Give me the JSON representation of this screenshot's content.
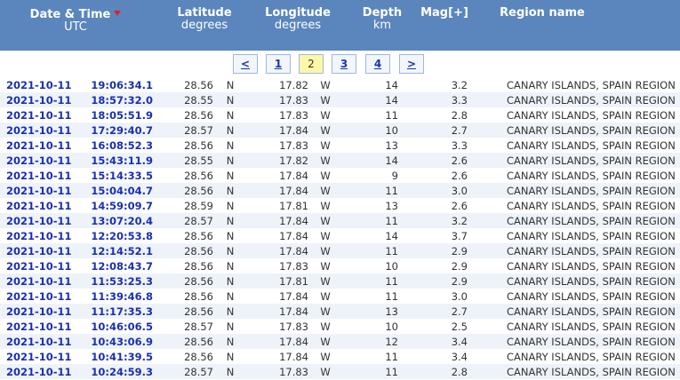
{
  "header": {
    "date": {
      "title": "Date & Time",
      "sub": "UTC"
    },
    "lat": {
      "title": "Latitude",
      "sub": "degrees"
    },
    "lon": {
      "title": "Longitude",
      "sub": "degrees"
    },
    "depth": {
      "title": "Depth",
      "sub": "km"
    },
    "mag": {
      "title": "Mag[+]"
    },
    "region": {
      "title": "Region name"
    },
    "sort_color": "#e0202a",
    "bg_color": "#5a86bd"
  },
  "pager": {
    "prev": "<",
    "p1": "1",
    "p2": "2",
    "p3": "3",
    "p4": "4",
    "next": ">",
    "current": "2"
  },
  "rows": [
    {
      "date": "2021-10-11",
      "time": "19:06:34.1",
      "lat": "28.56",
      "latdir": "N",
      "lon": "17.82",
      "londir": "W",
      "depth": "14",
      "mag": "3.2",
      "region": "CANARY ISLANDS, SPAIN REGION"
    },
    {
      "date": "2021-10-11",
      "time": "18:57:32.0",
      "lat": "28.55",
      "latdir": "N",
      "lon": "17.83",
      "londir": "W",
      "depth": "14",
      "mag": "3.3",
      "region": "CANARY ISLANDS, SPAIN REGION"
    },
    {
      "date": "2021-10-11",
      "time": "18:05:51.9",
      "lat": "28.56",
      "latdir": "N",
      "lon": "17.83",
      "londir": "W",
      "depth": "11",
      "mag": "2.8",
      "region": "CANARY ISLANDS, SPAIN REGION"
    },
    {
      "date": "2021-10-11",
      "time": "17:29:40.7",
      "lat": "28.57",
      "latdir": "N",
      "lon": "17.84",
      "londir": "W",
      "depth": "10",
      "mag": "2.7",
      "region": "CANARY ISLANDS, SPAIN REGION"
    },
    {
      "date": "2021-10-11",
      "time": "16:08:52.3",
      "lat": "28.56",
      "latdir": "N",
      "lon": "17.83",
      "londir": "W",
      "depth": "13",
      "mag": "3.3",
      "region": "CANARY ISLANDS, SPAIN REGION"
    },
    {
      "date": "2021-10-11",
      "time": "15:43:11.9",
      "lat": "28.55",
      "latdir": "N",
      "lon": "17.82",
      "londir": "W",
      "depth": "14",
      "mag": "2.6",
      "region": "CANARY ISLANDS, SPAIN REGION"
    },
    {
      "date": "2021-10-11",
      "time": "15:14:33.5",
      "lat": "28.56",
      "latdir": "N",
      "lon": "17.84",
      "londir": "W",
      "depth": "9",
      "mag": "2.6",
      "region": "CANARY ISLANDS, SPAIN REGION"
    },
    {
      "date": "2021-10-11",
      "time": "15:04:04.7",
      "lat": "28.56",
      "latdir": "N",
      "lon": "17.84",
      "londir": "W",
      "depth": "11",
      "mag": "3.0",
      "region": "CANARY ISLANDS, SPAIN REGION"
    },
    {
      "date": "2021-10-11",
      "time": "14:59:09.7",
      "lat": "28.59",
      "latdir": "N",
      "lon": "17.81",
      "londir": "W",
      "depth": "13",
      "mag": "2.6",
      "region": "CANARY ISLANDS, SPAIN REGION"
    },
    {
      "date": "2021-10-11",
      "time": "13:07:20.4",
      "lat": "28.57",
      "latdir": "N",
      "lon": "17.84",
      "londir": "W",
      "depth": "11",
      "mag": "3.2",
      "region": "CANARY ISLANDS, SPAIN REGION"
    },
    {
      "date": "2021-10-11",
      "time": "12:20:53.8",
      "lat": "28.56",
      "latdir": "N",
      "lon": "17.84",
      "londir": "W",
      "depth": "14",
      "mag": "3.7",
      "region": "CANARY ISLANDS, SPAIN REGION"
    },
    {
      "date": "2021-10-11",
      "time": "12:14:52.1",
      "lat": "28.56",
      "latdir": "N",
      "lon": "17.84",
      "londir": "W",
      "depth": "11",
      "mag": "2.9",
      "region": "CANARY ISLANDS, SPAIN REGION"
    },
    {
      "date": "2021-10-11",
      "time": "12:08:43.7",
      "lat": "28.56",
      "latdir": "N",
      "lon": "17.83",
      "londir": "W",
      "depth": "10",
      "mag": "2.9",
      "region": "CANARY ISLANDS, SPAIN REGION"
    },
    {
      "date": "2021-10-11",
      "time": "11:53:25.3",
      "lat": "28.56",
      "latdir": "N",
      "lon": "17.81",
      "londir": "W",
      "depth": "11",
      "mag": "2.9",
      "region": "CANARY ISLANDS, SPAIN REGION"
    },
    {
      "date": "2021-10-11",
      "time": "11:39:46.8",
      "lat": "28.56",
      "latdir": "N",
      "lon": "17.84",
      "londir": "W",
      "depth": "11",
      "mag": "3.0",
      "region": "CANARY ISLANDS, SPAIN REGION"
    },
    {
      "date": "2021-10-11",
      "time": "11:17:35.3",
      "lat": "28.56",
      "latdir": "N",
      "lon": "17.84",
      "londir": "W",
      "depth": "13",
      "mag": "2.7",
      "region": "CANARY ISLANDS, SPAIN REGION"
    },
    {
      "date": "2021-10-11",
      "time": "10:46:06.5",
      "lat": "28.57",
      "latdir": "N",
      "lon": "17.83",
      "londir": "W",
      "depth": "10",
      "mag": "2.5",
      "region": "CANARY ISLANDS, SPAIN REGION"
    },
    {
      "date": "2021-10-11",
      "time": "10:43:06.9",
      "lat": "28.56",
      "latdir": "N",
      "lon": "17.84",
      "londir": "W",
      "depth": "12",
      "mag": "3.4",
      "region": "CANARY ISLANDS, SPAIN REGION"
    },
    {
      "date": "2021-10-11",
      "time": "10:41:39.5",
      "lat": "28.56",
      "latdir": "N",
      "lon": "17.84",
      "londir": "W",
      "depth": "11",
      "mag": "3.4",
      "region": "CANARY ISLANDS, SPAIN REGION"
    },
    {
      "date": "2021-10-11",
      "time": "10:24:59.3",
      "lat": "28.57",
      "latdir": "N",
      "lon": "17.83",
      "londir": "W",
      "depth": "11",
      "mag": "2.8",
      "region": "CANARY ISLANDS, SPAIN REGION"
    }
  ]
}
